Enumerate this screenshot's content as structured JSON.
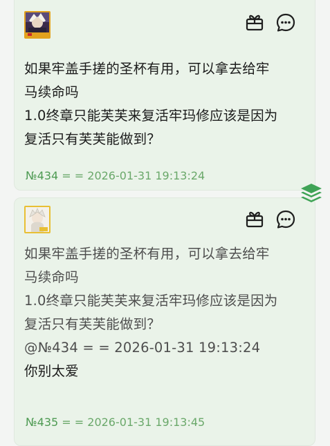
{
  "posts": [
    {
      "body_lines": [
        "如果牢盖手搓的圣杯有用，可以拿去给牢",
        "马续命吗",
        "1.0终章只能芙芙来复活牢玛修应该是因为",
        "复活只有芙芙能做到？"
      ],
      "post_id": "№434",
      "meta_sep": " = = ",
      "timestamp": "2026-01-31 19:13:24"
    },
    {
      "body_lines": [
        "如果牢盖手搓的圣杯有用，可以拿去给牢",
        "马续命吗",
        "1.0终章只能芙芙来复活牢玛修应该是因为",
        "复活只有芙芙能做到？"
      ],
      "quote_ref": "@№434 = = 2026-01-31 19:13:24",
      "reply": "你别太爱",
      "post_id": "№435",
      "meta_sep": " = = ",
      "timestamp": "2026-01-31 19:13:45"
    }
  ],
  "icons": {
    "gift": "gift-box-icon",
    "comment": "comment-bubble-icon",
    "layers": "layers-icon"
  },
  "colors": {
    "card_bg": "#eaf3e9",
    "page_bg": "#f3f5f3",
    "meta_green": "#6aa86a",
    "layers_green": "#3fa356"
  }
}
